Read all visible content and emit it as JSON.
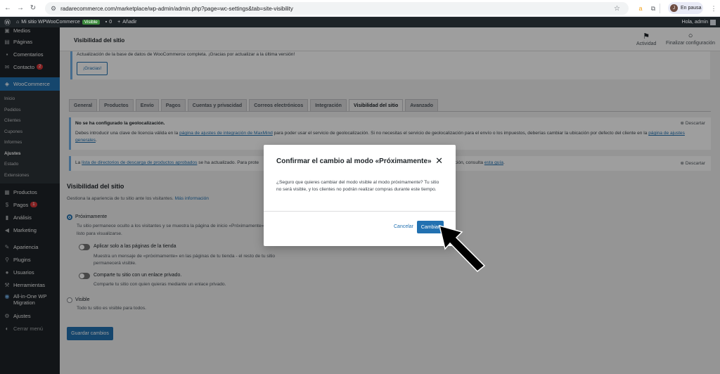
{
  "browser": {
    "url": "radarecommerce.com/marketplace/wp-admin/admin.php?page=wc-settings&tab=site-visibility",
    "profile_initial": "J",
    "profile_label": "En pausa"
  },
  "adminbar": {
    "site_name": "Mi sitio WPWooCommerce",
    "visibility_badge": "Visible",
    "comments_count": "0",
    "add_new": "Añadir",
    "greeting": "Hola, admin"
  },
  "sidebar": {
    "items_top": [
      {
        "label": "Medios",
        "icon": "media-icon"
      },
      {
        "label": "Páginas",
        "icon": "pages-icon"
      },
      {
        "label": "Comentarios",
        "icon": "comments-icon"
      },
      {
        "label": "Contacto",
        "icon": "mail-icon",
        "count": "2"
      }
    ],
    "woocommerce": "WooCommerce",
    "woo_sub": [
      "Inicio",
      "Pedidos",
      "Clientes",
      "Cupones",
      "Informes",
      "Ajustes",
      "Estado",
      "Extensiones"
    ],
    "items_bottom": [
      {
        "label": "Productos",
        "icon": "products-icon"
      },
      {
        "label": "Pagos",
        "icon": "payments-icon",
        "count": "1"
      },
      {
        "label": "Análisis",
        "icon": "analytics-icon"
      },
      {
        "label": "Marketing",
        "icon": "marketing-icon"
      },
      {
        "label": "Apariencia",
        "icon": "appearance-icon"
      },
      {
        "label": "Plugins",
        "icon": "plugins-icon"
      },
      {
        "label": "Usuarios",
        "icon": "users-icon"
      },
      {
        "label": "Herramientas",
        "icon": "tools-icon"
      },
      {
        "label": "All-in-One WP Migration",
        "icon": "migration-icon"
      },
      {
        "label": "Ajustes",
        "icon": "settings-icon"
      },
      {
        "label": "Cerrar menú",
        "icon": "collapse-icon"
      }
    ]
  },
  "header": {
    "title": "Visibilidad del sitio",
    "activity": "Actividad",
    "finish_setup": "Finalizar configuración"
  },
  "db_notice": {
    "text": "Actualización de la base de datos de WooCommerce completa. ¡Gracias por actualizar a la última versión!",
    "button": "¡Gracias!"
  },
  "tabs": [
    "General",
    "Productos",
    "Envío",
    "Pagos",
    "Cuentas y privacidad",
    "Correos electrónicos",
    "Integración",
    "Visibilidad del sitio",
    "Avanzado"
  ],
  "geo_notice": {
    "title": "No se ha configurado la geolocalización.",
    "dismiss": "Descartar",
    "text1": "Debes introducir una clave de licencia válida en la ",
    "link1": "página de ajustes de integración de MaxMind",
    "text2": " para poder usar el servicio de geolocalización. Si no necesitas el servicio de geolocalización para el envío o los impuestos, deberías cambiar la ubicación por defecto del cliente en la ",
    "link2": "página de ajustes generales",
    "text3": "."
  },
  "dir_notice": {
    "text1": "La ",
    "link1": "lista de directorios de descarga de productos aprobados",
    "text2": " se ha actualizado. Para prote",
    "text3": "ación, consulta ",
    "link2": "esta guía",
    "text4": ".",
    "dismiss": "Descartar"
  },
  "visibility": {
    "title": "Visibilidad del sitio",
    "desc": "Gestiona la apariencia de tu sitio ante los visitantes.",
    "more": "Más información",
    "coming_soon_label": "Próximamente",
    "coming_soon_desc1": "Tu sitio permanece oculto a los visitantes y se muestra la página de inicio «Próximamente»",
    "coming_soon_desc2": "listo para visualizarse.",
    "store_only_label": "Aplicar solo a las páginas de la tienda",
    "store_only_desc1": "Muestra un mensaje de «próximamente» en las páginas de tu tienda - el resto de tu sitio",
    "store_only_desc2": "permanecerá visible.",
    "share_label": "Comparte tu sitio con un enlace privado.",
    "share_desc": "Comparte tu sitio con quien quieras mediante un enlace privado.",
    "visible_label": "Visible",
    "visible_desc": "Todo tu sitio es visible para todos.",
    "save": "Guardar cambios"
  },
  "modal": {
    "title": "Confirmar el cambio al modo «Próximamente»",
    "body": "¿Seguro que quieres cambiar del modo visible al modo próximamente? Tu sitio no será visible, y los clientes no podrán realizar compras durante este tiempo.",
    "cancel": "Cancelar",
    "confirm": "Cambiar"
  }
}
